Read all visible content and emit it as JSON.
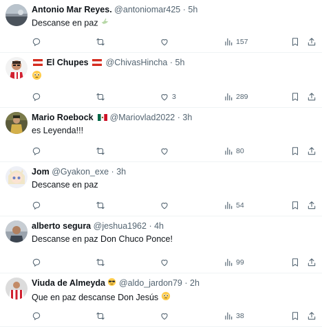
{
  "tweets": [
    {
      "name": "Antonio Mar Reyes.",
      "handle": "@antoniomar425",
      "time": "5h",
      "text": "Descanse en paz",
      "emoji_icon": "dove-icon",
      "reply": "",
      "retweet": "",
      "like": "",
      "views": "157"
    },
    {
      "name": "El Chupes",
      "handle": "@ChivasHincha",
      "time": "5h",
      "text": "",
      "emoji_icon": "pleading-face-icon",
      "reply": "",
      "retweet": "",
      "like": "3",
      "views": "289"
    },
    {
      "name": "Mario Roebock",
      "handle": "@Mariovlad2022",
      "time": "3h",
      "text": "es Leyenda!!!",
      "reply": "",
      "retweet": "",
      "like": "",
      "views": "80"
    },
    {
      "name": "Jom",
      "handle": "@Gyakon_exe",
      "time": "3h",
      "text": "Descanse en paz",
      "reply": "",
      "retweet": "",
      "like": "",
      "views": "54"
    },
    {
      "name": "alberto segura",
      "handle": "@jeshua1962",
      "time": "4h",
      "text": "Descanse en paz Don Chuco Ponce!",
      "reply": "",
      "retweet": "",
      "like": "",
      "views": "99"
    },
    {
      "name": "Viuda de Almeyda",
      "handle": "@aldo_jardon79",
      "time": "2h",
      "text": "Que en paz descanse Don Jesús",
      "emoji_icon": "pleading-face-icon",
      "reply": "",
      "retweet": "",
      "like": "",
      "views": "38"
    }
  ],
  "separator": "·",
  "colors": {
    "text": "#0f1419",
    "secondary": "#536471",
    "border": "#eff3f4"
  }
}
